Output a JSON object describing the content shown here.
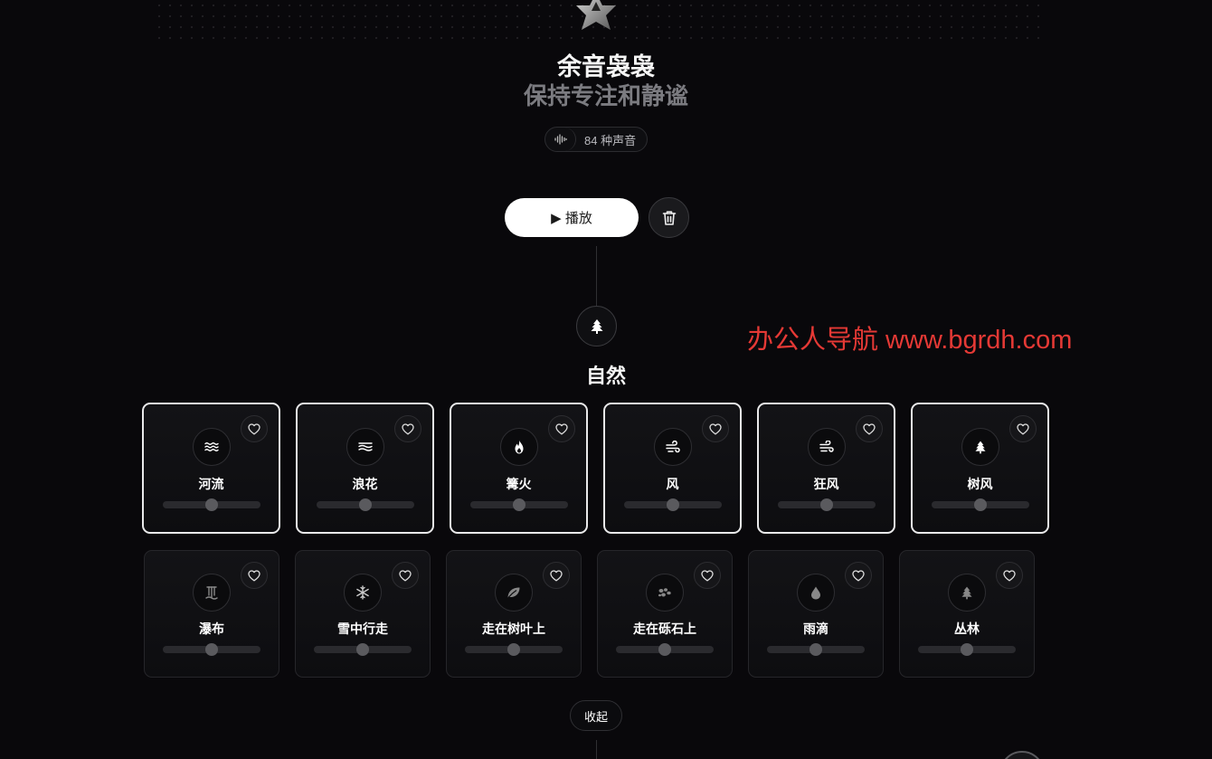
{
  "header": {
    "title": "余音袅袅",
    "subtitle": "保持专注和静谧",
    "sound_count": "84 种声音",
    "logo_icon": "star-logo-icon",
    "count_icon": "sound-wave-icon"
  },
  "controls": {
    "play_label": "▶ 播放",
    "clear_icon": "trash-icon"
  },
  "category": {
    "icon": "tree-icon",
    "title": "自然",
    "collapse_label": "收起",
    "sounds": [
      {
        "label": "河流",
        "icon": "water-waves-icon",
        "selected": true,
        "volume": 0.5
      },
      {
        "label": "浪花",
        "icon": "sea-waves-icon",
        "selected": true,
        "volume": 0.5
      },
      {
        "label": "篝火",
        "icon": "fire-icon",
        "selected": true,
        "volume": 0.5
      },
      {
        "label": "风",
        "icon": "wind-icon",
        "selected": true,
        "volume": 0.5
      },
      {
        "label": "狂风",
        "icon": "strong-wind-icon",
        "selected": true,
        "volume": 0.5
      },
      {
        "label": "树风",
        "icon": "tree-icon",
        "selected": true,
        "volume": 0.5
      },
      {
        "label": "瀑布",
        "icon": "waterfall-icon",
        "selected": false,
        "volume": 0.5
      },
      {
        "label": "雪中行走",
        "icon": "snowflake-icon",
        "selected": false,
        "volume": 0.5
      },
      {
        "label": "走在树叶上",
        "icon": "leaf-icon",
        "selected": false,
        "volume": 0.5
      },
      {
        "label": "走在砾石上",
        "icon": "gravel-icon",
        "selected": false,
        "volume": 0.5
      },
      {
        "label": "雨滴",
        "icon": "droplet-icon",
        "selected": false,
        "volume": 0.5
      },
      {
        "label": "丛林",
        "icon": "pine-tree-icon",
        "selected": false,
        "volume": 0.5
      }
    ]
  },
  "watermark": "办公人导航  www.bgrdh.com",
  "colors": {
    "background": "#09080b",
    "accent": "#ffffff",
    "watermark": "#e53935"
  }
}
